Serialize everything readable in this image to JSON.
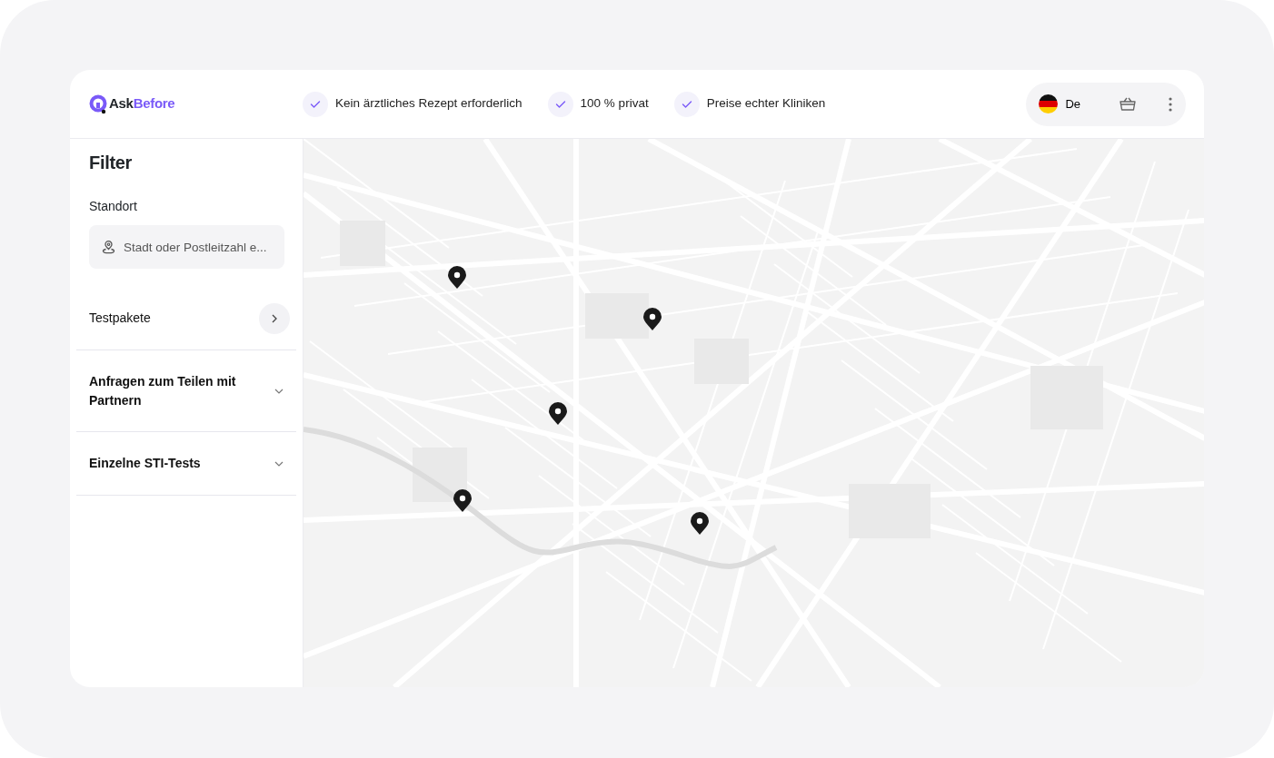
{
  "header": {
    "logo": {
      "part_1": "Ask",
      "part_2": "Before"
    },
    "features": [
      "Kein ärztliches Rezept erforderlich",
      "100 % privat",
      "Preise echter Kliniken"
    ],
    "language": "De"
  },
  "sidebar": {
    "title": "Filter",
    "location_label": "Standort",
    "location_field": {
      "placeholder": "Stadt oder Postleitzahl e..."
    },
    "sections": [
      {
        "label": "Testpakete",
        "kind": "link"
      },
      {
        "label": "Anfragen zum Teilen mit Partnern",
        "kind": "accordion",
        "expanded": false
      },
      {
        "label": "Einzelne STI-Tests",
        "kind": "accordion",
        "expanded": false
      }
    ]
  }
}
